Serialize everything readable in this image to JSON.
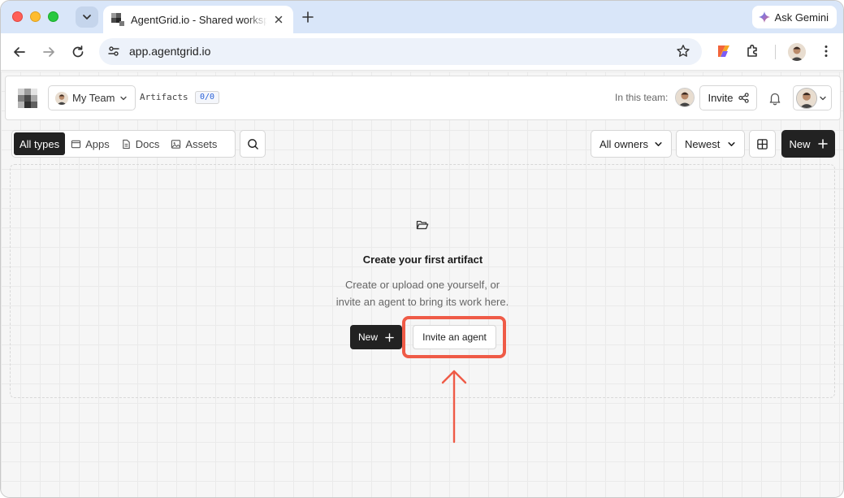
{
  "browser": {
    "tab_title": "AgentGrid.io - Shared workspace",
    "url": "app.agentgrid.io",
    "gemini_label": "Ask Gemini"
  },
  "header": {
    "team_label": "My Team",
    "artifacts_label": "Artifacts",
    "artifacts_count": "0/0",
    "in_team_label": "In this team:",
    "invite_label": "Invite"
  },
  "filters": {
    "types": [
      {
        "label": "All types",
        "icon": "none",
        "active": true
      },
      {
        "label": "Apps",
        "icon": "window-icon",
        "active": false
      },
      {
        "label": "Docs",
        "icon": "document-icon",
        "active": false
      },
      {
        "label": "Assets",
        "icon": "image-icon",
        "active": false
      }
    ],
    "owners_label": "All owners",
    "sort_label": "Newest",
    "new_label": "New"
  },
  "empty_state": {
    "title": "Create your first artifact",
    "description_line1": "Create or upload one yourself, or",
    "description_line2": "invite an agent to bring its work here.",
    "new_label": "New",
    "invite_agent_label": "Invite an agent"
  },
  "colors": {
    "tabstrip_bg": "#d9e6f9",
    "dark_button": "#222222",
    "highlight": "#ef5b47",
    "count_badge_text": "#2a62d8"
  }
}
